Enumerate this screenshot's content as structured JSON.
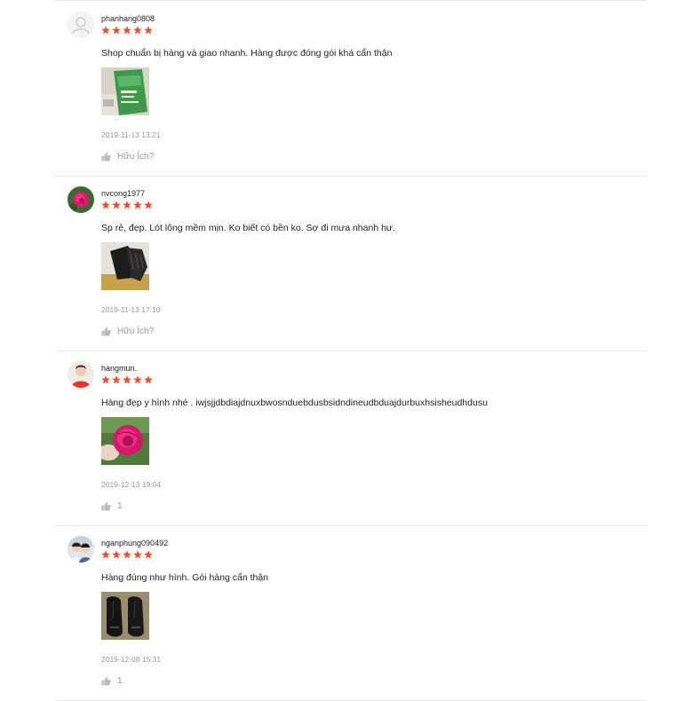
{
  "colors": {
    "star": "#ee4d2d",
    "muted": "#999999",
    "divider": "#e8e8e8"
  },
  "reviews": [
    {
      "username": "phanhang0808",
      "rating": 5,
      "comment": "Shop chuẩn bị hàng và giao nhanh. Hàng được đóng gói khá cẩn thận",
      "time": "2019-11-13 13:21",
      "helpful": "Hữu Ích?",
      "avatar_icon": "default-user-icon",
      "photo_icon": "green-package-photo"
    },
    {
      "username": "nvcong1977",
      "rating": 5,
      "comment": "Sp rẻ, đẹp. Lót lông mềm mịn. Ko biết có bền ko. Sợ đi mưa nhanh hư.",
      "time": "2019-11-13 17:10",
      "helpful": "Hữu Ích?",
      "avatar_icon": "pink-rose-avatar",
      "photo_icon": "black-gloves-photo"
    },
    {
      "username": "hangmun.",
      "rating": 5,
      "comment": "Hàng đẹp y hình nhé . iwjsjjdbdiajdnuxbwosnduebdusbsidndineudbduajdurbuxhsisheudhdusu",
      "time": "2019-12-13 19:04",
      "helpful": "1",
      "avatar_icon": "person-red-shirt-avatar",
      "photo_icon": "pink-rose-photo"
    },
    {
      "username": "nganphung090492",
      "rating": 5,
      "comment": "Hàng đúng như hình. Gói hàng cẩn thận",
      "time": "2019-12-08 15:31",
      "helpful": "1",
      "avatar_icon": "couple-photo-avatar",
      "photo_icon": "leather-gloves-photo"
    }
  ]
}
